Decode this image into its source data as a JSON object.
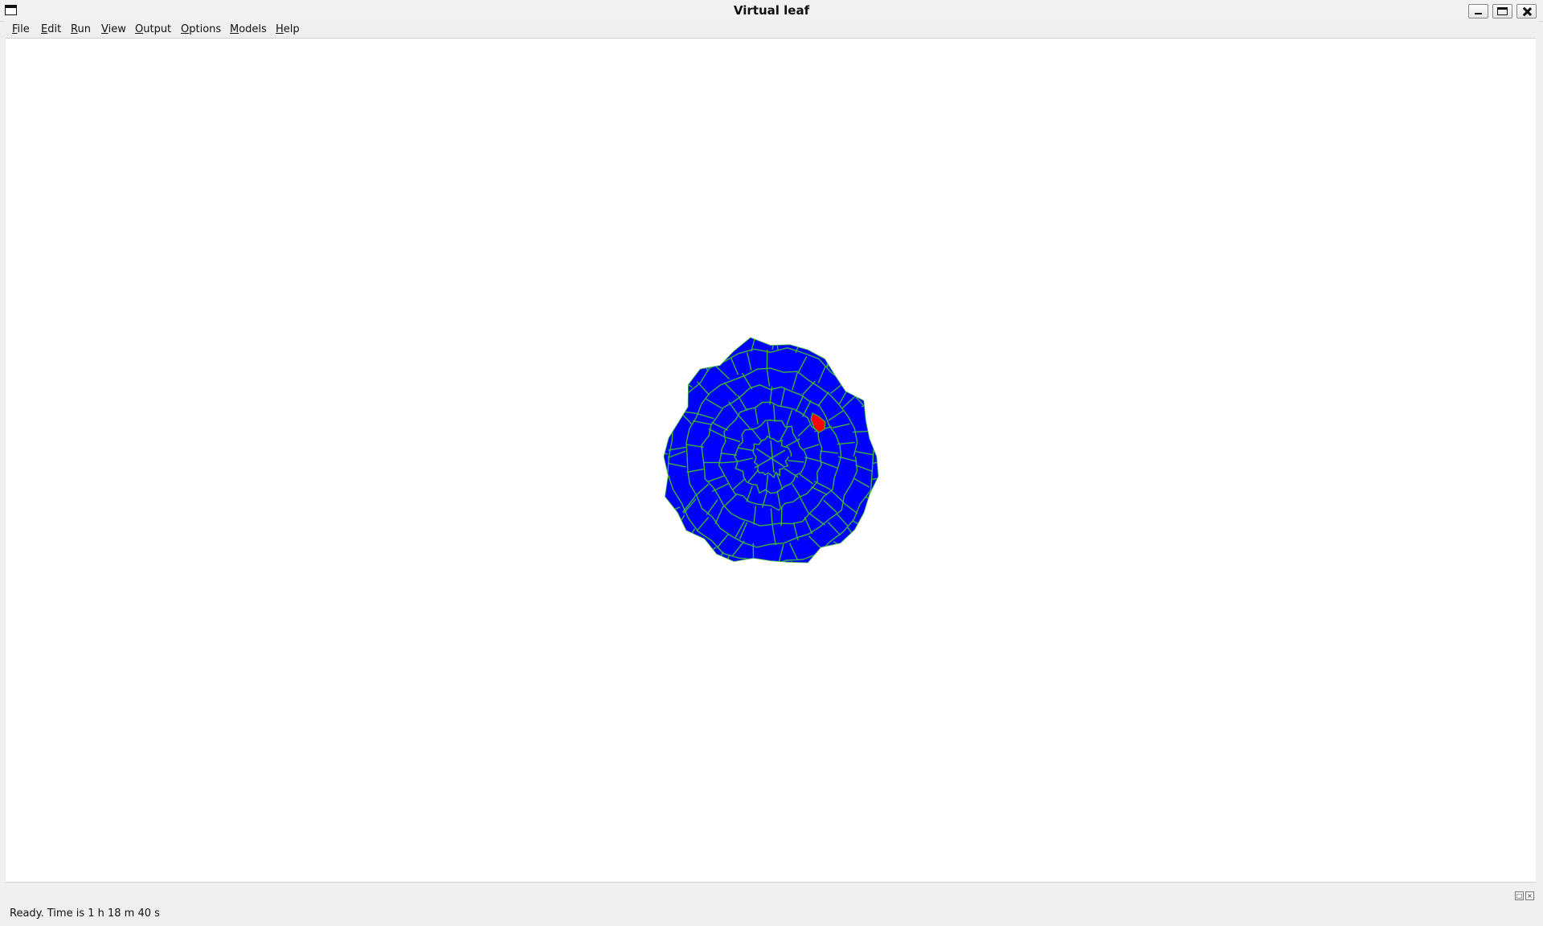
{
  "window": {
    "title": "Virtual leaf",
    "controls": {
      "minimize": "minimize-icon",
      "maximize": "maximize-icon",
      "close": "close-icon"
    }
  },
  "menubar": {
    "items": [
      {
        "label": "File",
        "mnemonic": "F"
      },
      {
        "label": "Edit",
        "mnemonic": "E"
      },
      {
        "label": "Run",
        "mnemonic": "R"
      },
      {
        "label": "View",
        "mnemonic": "V"
      },
      {
        "label": "Output",
        "mnemonic": "O"
      },
      {
        "label": "Options",
        "mnemonic": "O"
      },
      {
        "label": "Models",
        "mnemonic": "M"
      },
      {
        "label": "Help",
        "mnemonic": "H"
      }
    ]
  },
  "canvas": {
    "tissue": {
      "cell_fill": "#0000ff",
      "wall_color": "#3cb43c",
      "highlight_fill": "#ff0000",
      "background": "#ffffff"
    }
  },
  "statusbar": {
    "text": "Ready. Time is 1 h 18 m 40 s"
  }
}
